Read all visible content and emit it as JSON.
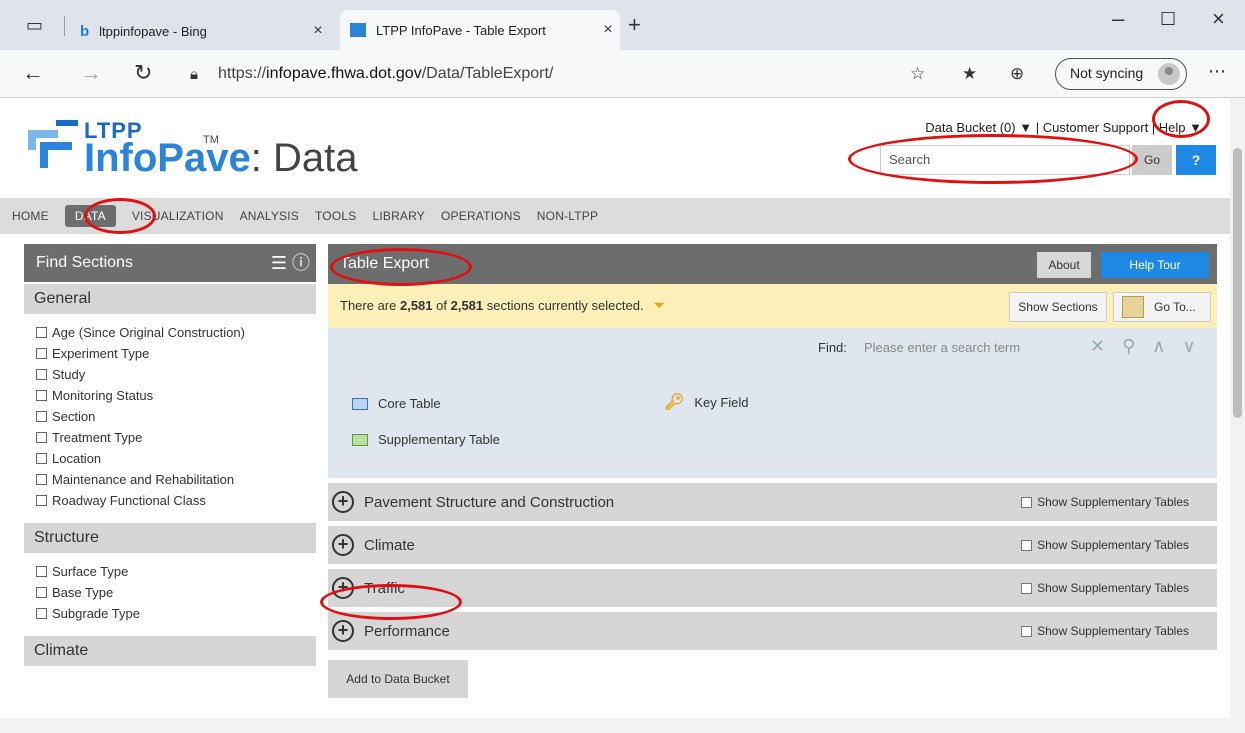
{
  "browser": {
    "tabs": [
      {
        "title": "ltppinfopave - Bing"
      },
      {
        "title": "LTPP InfoPave - Table Export"
      }
    ],
    "url_prefix": "https://",
    "url_host": "infopave.fhwa.dot.gov",
    "url_path": "/Data/TableExport/",
    "sync_label": "Not syncing"
  },
  "header": {
    "logo_top": "LTPP",
    "logo_main": "InfoPave",
    "logo_tm": "TM",
    "logo_suffix": ": Data",
    "top_links": "Data Bucket (0) ▼  |  Customer Support  |  Help ▼",
    "search_placeholder": "Search",
    "go_label": "Go",
    "help_q": "?"
  },
  "nav": [
    "HOME",
    "DATA",
    "VISUALIZATION",
    "ANALYSIS",
    "TOOLS",
    "LIBRARY",
    "OPERATIONS",
    "NON-LTPP"
  ],
  "sidebar": {
    "title": "Find Sections",
    "icons": "☰ ⓘ",
    "sections": [
      {
        "name": "General",
        "items": [
          "Age (Since Original Construction)",
          "Experiment Type",
          "Study",
          "Monitoring Status",
          "Section",
          "Treatment Type",
          "Location",
          "Maintenance and Rehabilitation",
          "Roadway Functional Class"
        ]
      },
      {
        "name": "Structure",
        "items": [
          "Surface Type",
          "Base Type",
          "Subgrade Type"
        ]
      },
      {
        "name": "Climate",
        "items": []
      }
    ]
  },
  "main": {
    "title": "Table Export",
    "about_label": "About",
    "helptour_label": "Help Tour",
    "notice_prefix": "There are ",
    "notice_count": "2,581",
    "notice_of": " of ",
    "notice_total": "2,581",
    "notice_suffix": " sections currently selected.",
    "show_sections_label": "Show Sections",
    "goto_label": "Go To...",
    "find_label": "Find:",
    "find_placeholder": "Please enter a search term",
    "legend": {
      "core": "Core Table",
      "supplementary": "Supplementary Table",
      "key": "Key Field"
    },
    "categories": [
      {
        "title": "Pavement Structure and Construction",
        "checkbox": "Show Supplementary Tables"
      },
      {
        "title": "Climate",
        "checkbox": "Show Supplementary Tables"
      },
      {
        "title": "Traffic",
        "checkbox": "Show Supplementary Tables"
      },
      {
        "title": "Performance",
        "checkbox": "Show Supplementary Tables"
      }
    ],
    "add_bucket_label": "Add to Data Bucket"
  }
}
